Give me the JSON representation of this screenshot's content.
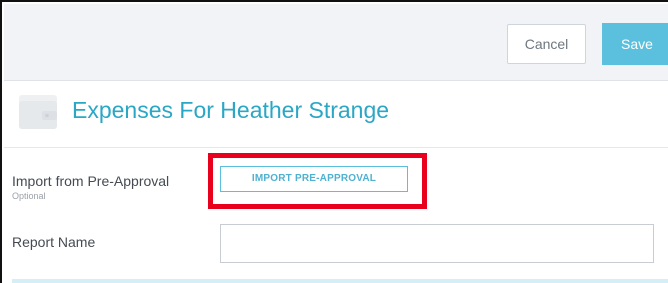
{
  "toolbar": {
    "cancel_label": "Cancel",
    "save_label": "Save",
    "save_color": "#5bc0de"
  },
  "header": {
    "title": "Expenses For Heather Strange",
    "title_color": "#2aa7c5",
    "icon": "wallet-icon"
  },
  "form": {
    "import": {
      "label": "Import from Pre-Approval",
      "sublabel": "Optional",
      "button_label": "IMPORT PRE-APPROVAL",
      "highlight_color": "#e8001c"
    },
    "report_name": {
      "label": "Report Name",
      "value": ""
    }
  }
}
